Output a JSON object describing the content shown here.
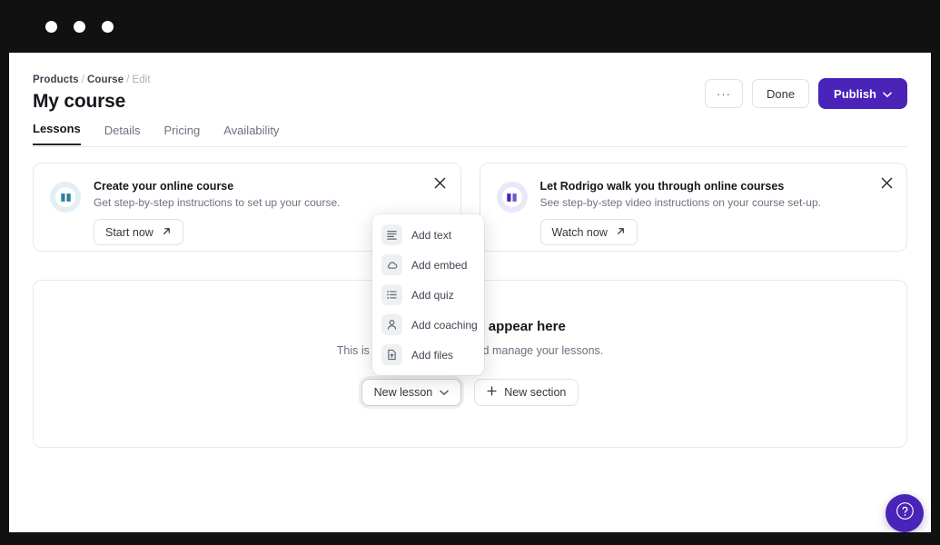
{
  "window": {
    "traffic_dots": 3
  },
  "header": {
    "breadcrumb": {
      "item1": "Products",
      "item2": "Course",
      "item3": "Edit",
      "separator": "/"
    },
    "title": "My course",
    "tabs": [
      {
        "label": "Lessons",
        "active": true
      },
      {
        "label": "Details",
        "active": false
      },
      {
        "label": "Pricing",
        "active": false
      },
      {
        "label": "Availability",
        "active": false
      }
    ],
    "actions": {
      "more_label": "···",
      "done_label": "Done",
      "publish_label": "Publish",
      "publish_chevron": "⌄"
    }
  },
  "cards": [
    {
      "icon": "book-icon",
      "icon_color": "#2b7f9e",
      "title": "Create your online course",
      "description": "Get step-by-step instructions to set up your course.",
      "button_label": "Start now",
      "button_icon": "arrow-up-right-icon",
      "close_icon": "close-icon"
    },
    {
      "icon": "book-icon",
      "icon_color": "#4a23b8",
      "title": "Let Rodrigo walk you through online courses",
      "description": "See step-by-step video instructions on your course set-up.",
      "button_label": "Watch now",
      "button_icon": "arrow-up-right-icon",
      "close_icon": "close-icon"
    }
  ],
  "lessons_panel": {
    "empty_title": "Your lessons will appear here",
    "empty_description": "This is where you'll create and manage your lessons.",
    "new_lesson_label": "New lesson",
    "new_lesson_chevron": "⌄",
    "new_section_label": "New section",
    "new_section_icon": "plus-icon"
  },
  "menu": {
    "items": [
      {
        "label": "Add text",
        "icon": "text-lines-icon"
      },
      {
        "label": "Add embed",
        "icon": "cloud-icon"
      },
      {
        "label": "Add quiz",
        "icon": "list-icon"
      },
      {
        "label": "Add coaching",
        "icon": "person-icon"
      },
      {
        "label": "Add files",
        "icon": "file-upload-icon"
      }
    ]
  },
  "help": {
    "icon": "question-mark-icon",
    "label": "?"
  },
  "colors": {
    "accent_purple": "#4a23b8",
    "teal": "#2b7f9e",
    "text_dark": "#15171c",
    "text_muted": "#6b7280",
    "border": "#e7e8ec",
    "titlebar": "#111111"
  }
}
